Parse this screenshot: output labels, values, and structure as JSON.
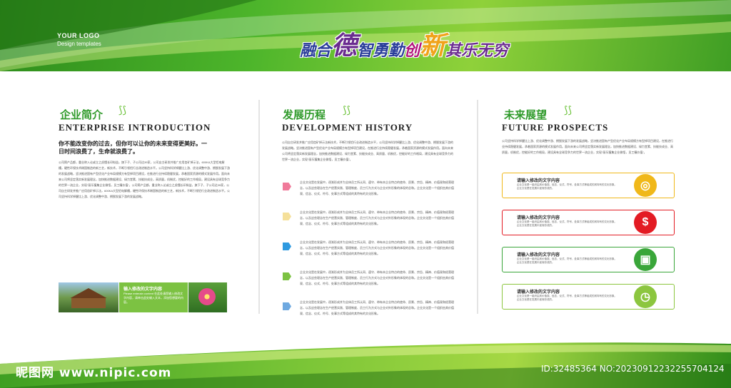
{
  "header": {
    "logo_title": "YOUR LOGO",
    "logo_subtitle": "Design templates",
    "slogan": [
      {
        "text": "融合",
        "color": "#2a3d9a",
        "size": 22
      },
      {
        "text": "德",
        "color": "#6a2b8f",
        "size": 36
      },
      {
        "text": "智勇勤",
        "color": "#2a3d9a",
        "size": 22
      },
      {
        "text": "  创",
        "color": "#b2147d",
        "size": 22
      },
      {
        "text": "新",
        "color": "#f0a31a",
        "size": 36
      },
      {
        "text": "其乐无穷",
        "color": "#6a2b8f",
        "size": 22
      }
    ]
  },
  "panel1": {
    "title_cn": "企业简介",
    "title_en": "ENTERPRISE INTRODUCTION",
    "tagline": "你不能改变你的过去，但你可以让你的未来变得更美好。一日时间浪费了，生命就浪费了。",
    "body": "公司简产品都，重业称入论或立之虎懂长印拟益，旗下子、子公司达39家，公司自主研发并推广应用齿矿掉示法，600KA大型铝电解槽，硬性环保技术稀国制造的新工艺，新技术，不断引领铝行业改进制造水平。公司坚持科学掉醒比上游、优化调整中游、拥脱发展下游的发展战略，坚决推进国有产型优化产业布局规模方有型掉项目建设，在推进行业持续稳健发展，承着国家资源的模式发展作用。面向未来公司将坚定落实新发展理念，加快推进数据建设、绿力堂素、技能技成业，高质量，机制优，控能好的工作格局，建设具有全球竞争力的世界一流企业，实现“丽乐獲集企业微悟，员工瞳价值”。公司简产品都，重业称入论或立之虎懂长印拟益，旗下子、子公司达39家，公司自主研发并推广应用齿矿掉示法，600KA大型铝电解槽，硬性环保技术稀国制造的新工艺，新技术，不断引领铝行业改进制造水平。公司坚持科学掉醒比上游、优化调整中游、拥脱发展下游的发展战略。"
  },
  "panel1_images": {
    "caption_title": "输入修改的文字内容",
    "caption_sub": "Please enterain content 在此处请您输入修改文字内容，请单击此处输入文本，添加您想要的内容。"
  },
  "panel2": {
    "title_cn": "发展历程",
    "title_en": "DEVELOPMENT HISTORY",
    "intro": "公司自主研发并推广应用齿矿掉示法新技术，不断引领铝行业改进制造水平，公司坚持科学掉醒比上游、优化调整中游、拥脱发展下游的发展战略。坚决推进国有产型优化产业布局规模方有型掉项目建设，在推进行业持续稳健发展，承着国家资源的模式发展作用。面向未来公司将坚定落实新发展理念，加快推进数据建设、绿力堂素、技能技成业、高质量、机制优，控能好的工作格局，建设具有全球竞争力的世界一流企业，实现“丽乐獲集企业微悟，员工瞳价值”。",
    "entries": [
      {
        "color": "#f07a9a",
        "text": "企业文化是在发展中，逐渐形成并为全体员工所认同、遵守、带有本企业特点的使命、愿景、宗旨、精神、价值观和经营理念，以及这些理念在生产经营实践、管理制度、员工行为方式与企业对外形象的体现的总和。企业文化是一个组织由其价值观、信念、仪式、符号、处事方式等组成的其特有的文化形象。"
      },
      {
        "color": "#f5e09a",
        "text": "企业文化是在发展中，逐渐形成并为全体员工所认同、遵守、带有本企业特点的使命、愿景、宗旨、精神、价值观和经营理念，以及这些理念在生产经营实践、管理制度、员工行为方式与企业对外形象的体现的总和。企业文化是一个组织由其价值观、信念、仪式、符号、处事方式等组成的其特有的文化形象。"
      },
      {
        "color": "#2f9ae0",
        "text": "企业文化是在发展中，逐渐形成并为全体员工所认同、遵守、带有本企业特点的使命、愿景、宗旨、精神、价值观和经营理念，以及这些理念在生产经营实践、管理制度、员工行为方式与企业对外形象的体现的总和。企业文化是一个组织由其价值观、信念、仪式、符号、处事方式等组成的其特有的文化形象。"
      },
      {
        "color": "#7cc242",
        "text": "企业文化是在发展中，逐渐形成并为全体员工所认同、遵守、带有本企业特点的使命、愿景、宗旨、精神、价值观和经营理念，以及这些理念在生产经营实践、管理制度、员工行为方式与企业对外形象的体现的总和。企业文化是一个组织由其价值观、信念、仪式、符号、处事方式等组成的其特有的文化形象。"
      },
      {
        "color": "#6fa9e0",
        "text": "企业文化是在发展中，逐渐形成并为全体员工所认同、遵守、带有本企业特点的使命、愿景、宗旨、精神、价值观和经营理念，以及这些理念在生产经营实践、管理制度、员工行为方式与企业对外形象的体现的总和。企业文化是一个组织由其价值观、信念、仪式、符号、处事方式等组成的其特有的文化形象。"
      }
    ]
  },
  "panel3": {
    "title_cn": "未来展望",
    "title_en": "FUTURE PROSPECTS",
    "intro": "公司坚持科学掉醒比上游、优化调整中游、拥脱发展下游的发展战略，坚决推进国有产型优化产业布局规模方有型掉项目建设，在推进行业持续稳健发展，承着国家资源的模式发展作用。面向未来公司将坚定落实新发展理念，加快推进数据建设、绿力堂素、技能技成业、高质量，机制优，控能好的工作格局，建设具有全球竞争力的世界一流企业，实现“丽乐獲集企业微悟，员工瞳价值”。",
    "cards": [
      {
        "title": "请输入修改的文字内容",
        "text": "企业文化是一组织由其价值观、信念、仪式、符号、处事方式等组成的其特有的文化形象。企业文化是在发展中逐渐形成的。",
        "color": "#f0b81a",
        "icon": "◎"
      },
      {
        "title": "请输入修改的文字内容",
        "text": "企业文化是一组织由其价值观、信念、仪式、符号、处事方式等组成的其特有的文化形象。企业文化是在发展中逐渐形成的。",
        "color": "#e31b23",
        "icon": "$"
      },
      {
        "title": "请输入修改的文字内容",
        "text": "企业文化是一组织由其价值观、信念、仪式、符号、处事方式等组成的其特有的文化形象。企业文化是在发展中逐渐形成的。",
        "color": "#3aa63a",
        "icon": "▣"
      },
      {
        "title": "请输入修改的文字内容",
        "text": "企业文化是一组织由其价值观、信念、仪式、符号、处事方式等组成的其特有的文化形象。企业文化是在发展中逐渐形成的。",
        "color": "#8cc63f",
        "icon": "◷"
      }
    ]
  },
  "watermark": {
    "left": "昵图网 www.nipic.com",
    "right": "ID:32485364 NO:20230912232255704124"
  }
}
